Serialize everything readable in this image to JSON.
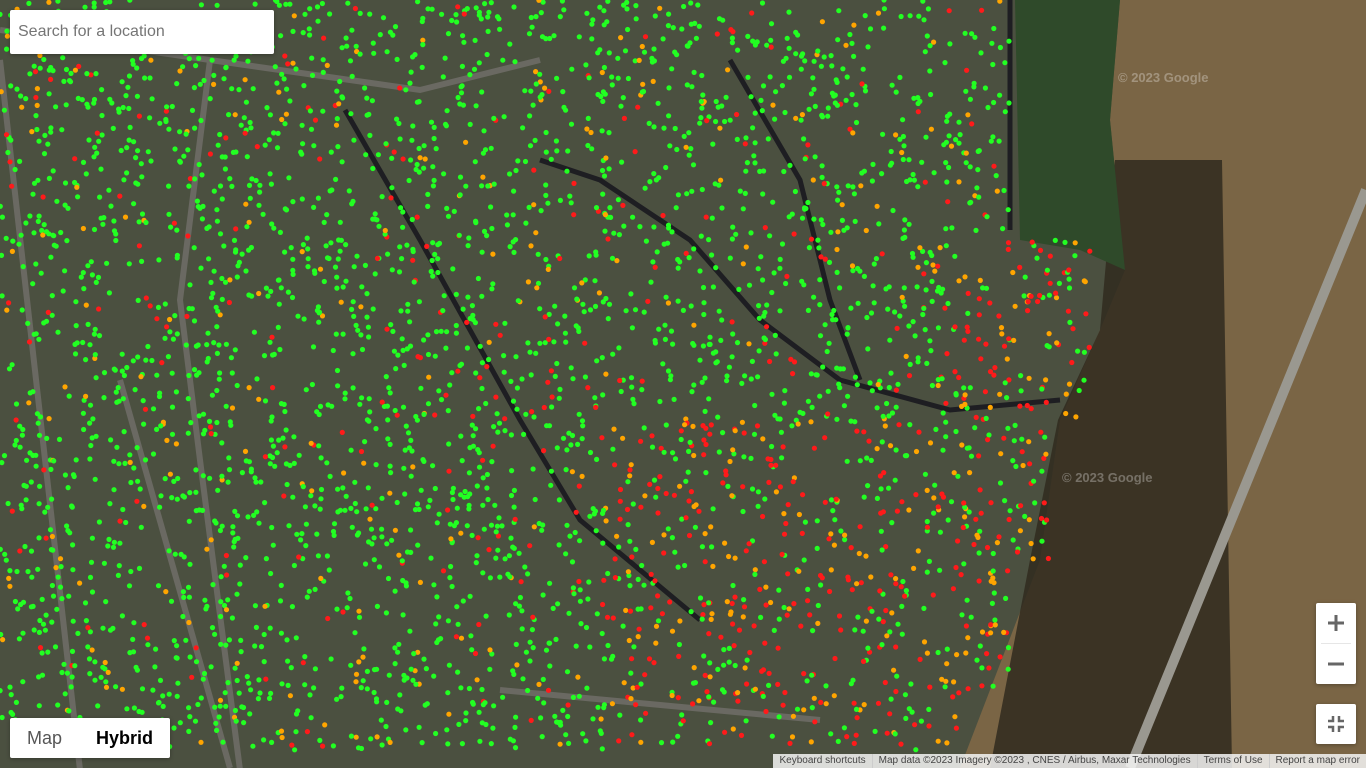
{
  "search": {
    "placeholder": "Search for a location"
  },
  "map_type": {
    "map_label": "Map",
    "hybrid_label": "Hybrid",
    "selected": "Hybrid"
  },
  "zoom": {
    "in_icon": "plus-icon",
    "out_icon": "minus-icon"
  },
  "fullscreen": {
    "icon": "exit-fullscreen-icon"
  },
  "watermark": "© 2023 Google",
  "footer": {
    "keyboard": "Keyboard shortcuts",
    "attribution": "Map data ©2023 Imagery ©2023 , CNES / Airbus, Maxar Technologies",
    "terms": "Terms of Use",
    "report": "Report a map error"
  },
  "colors": {
    "good": "#22ff22",
    "moderate": "#ffa500",
    "bad": "#ff1a1a",
    "water": "#7a6545",
    "land": "#4b5040"
  }
}
